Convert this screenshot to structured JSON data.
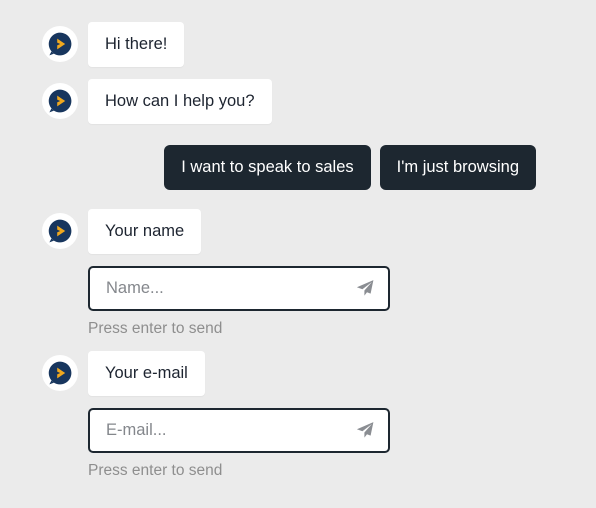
{
  "theme": {
    "background": "#ebebeb",
    "bubble_bg": "#ffffff",
    "bubble_text": "#1d2430",
    "button_bg": "#1d2730",
    "button_text": "#ffffff",
    "input_border": "#1d2730",
    "placeholder_text": "#84878c",
    "hint_text": "#8e8e8e",
    "avatar_bubble": "#18365e",
    "avatar_arrow": "#f0a81e"
  },
  "avatar": {
    "icon": "chat-bubble-play-icon"
  },
  "messages": [
    {
      "sender": "bot",
      "text": "Hi there!"
    },
    {
      "sender": "bot",
      "text": "How can I help you?"
    }
  ],
  "quick_replies": [
    {
      "label": "I want to speak to sales"
    },
    {
      "label": "I'm just browsing"
    }
  ],
  "prompts": [
    {
      "bubble": "Your name",
      "placeholder": "Name...",
      "value": "",
      "hint": "Press enter to send",
      "send_icon": "paper-plane-icon"
    },
    {
      "bubble": "Your e-mail",
      "placeholder": "E-mail...",
      "value": "",
      "hint": "Press enter to send",
      "send_icon": "paper-plane-icon"
    }
  ]
}
